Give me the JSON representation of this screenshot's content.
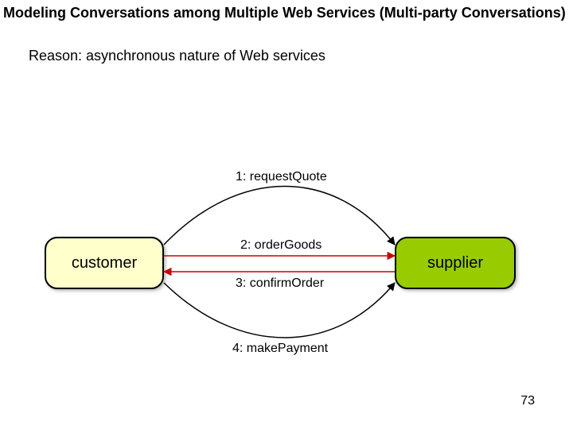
{
  "title": "Modeling Conversations among Multiple Web Services (Multi-party Conversations)",
  "reason": "Reason: asynchronous nature of Web services",
  "nodes": {
    "customer": {
      "label": "customer",
      "fill": "#FFFFCC"
    },
    "supplier": {
      "label": "supplier",
      "fill": "#99CC00"
    }
  },
  "messages": {
    "m1": "1: requestQuote",
    "m2": "2: orderGoods",
    "m3": "3: confirmOrder",
    "m4": "4: makePayment"
  },
  "page_number": "73",
  "chart_data": {
    "type": "sequence-overview",
    "parties": [
      "customer",
      "supplier"
    ],
    "interactions": [
      {
        "step": 1,
        "from": "customer",
        "to": "supplier",
        "label": "requestQuote"
      },
      {
        "step": 2,
        "from": "customer",
        "to": "supplier",
        "label": "orderGoods"
      },
      {
        "step": 3,
        "from": "supplier",
        "to": "customer",
        "label": "confirmOrder"
      },
      {
        "step": 4,
        "from": "customer",
        "to": "supplier",
        "label": "makePayment"
      }
    ]
  }
}
